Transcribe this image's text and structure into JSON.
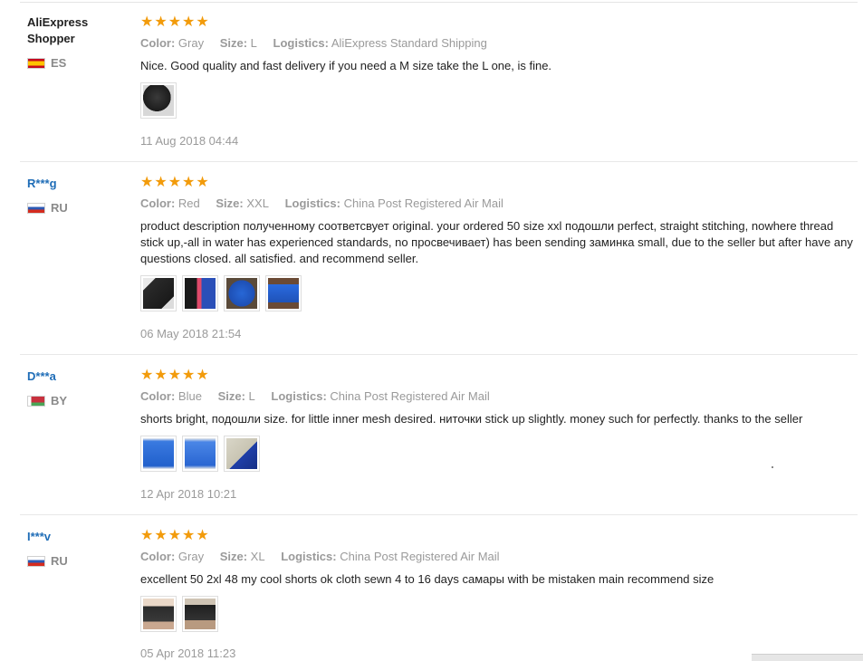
{
  "reviews": [
    {
      "user": "AliExpress Shopper",
      "country": "ES",
      "stars": 5,
      "attributes": [
        {
          "key": "Color:",
          "value": "Gray"
        },
        {
          "key": "Size:",
          "value": "L"
        },
        {
          "key": "Logistics:",
          "value": "AliExpress Standard Shipping"
        }
      ],
      "text": "Nice. Good quality and fast delivery if you need a M size take the L one, is fine.",
      "date": "11 Aug 2018 04:44"
    },
    {
      "user": "R***g",
      "country": "RU",
      "stars": 5,
      "attributes": [
        {
          "key": "Color:",
          "value": "Red"
        },
        {
          "key": "Size:",
          "value": "XXL"
        },
        {
          "key": "Logistics:",
          "value": "China Post Registered Air Mail"
        }
      ],
      "text": "product description полученному соответсвует original. your ordered 50 size xxl подошли perfect, straight stitching, nowhere thread stick up,-all in water has experienced standards, no просвечивает) has been sending заминка small, due to the seller but after have any questions closed. all satisfied. and recommend seller.",
      "date": "06 May 2018 21:54"
    },
    {
      "user": "D***a",
      "country": "BY",
      "stars": 5,
      "attributes": [
        {
          "key": "Color:",
          "value": "Blue"
        },
        {
          "key": "Size:",
          "value": "L"
        },
        {
          "key": "Logistics:",
          "value": "China Post Registered Air Mail"
        }
      ],
      "text": "shorts bright, подошли size. for little inner mesh desired. ниточки stick up slightly. money such for perfectly. thanks to the seller",
      "date": "12 Apr 2018 10:21"
    },
    {
      "user": "I***v",
      "country": "RU",
      "stars": 5,
      "attributes": [
        {
          "key": "Color:",
          "value": "Gray"
        },
        {
          "key": "Size:",
          "value": "XL"
        },
        {
          "key": "Logistics:",
          "value": "China Post Registered Air Mail"
        }
      ],
      "text": "excellent 50 2xl 48 my cool shorts ok cloth sewn 4 to 16 days самары with be mistaken main recommend size",
      "date": "05 Apr 2018 11:23"
    }
  ],
  "star_glyph": "★",
  "colors": {
    "star": "#f29b0b",
    "username_link": "#1f6db7",
    "muted": "#9a9a9a"
  }
}
